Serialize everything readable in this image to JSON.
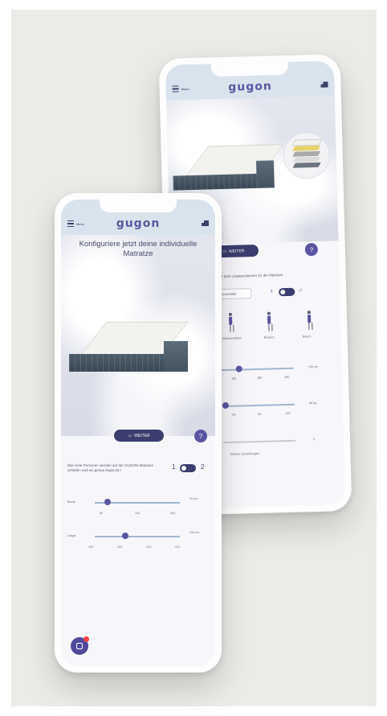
{
  "back_phone": {
    "menu_label": "Menü",
    "logo": "gugon",
    "hero_button": "WEITER",
    "info_text": "Wähle dein Liegepositionen für die Matratze",
    "select_value": "Seitenschläfer",
    "symbols": [
      "♀",
      "♂"
    ],
    "positions": [
      "Seitenschläfer",
      "Rücken",
      "Bauch"
    ],
    "height_unit": "180 cm",
    "height_ticks": [
      "150",
      "180",
      "200"
    ],
    "weight_unit": "80 kg",
    "weight_ticks": [
      "50",
      "80",
      "100"
    ],
    "footer_value": "0",
    "footer_link": "Weitere Einstellungen"
  },
  "front_phone": {
    "menu_label": "Menü",
    "logo": "gugon",
    "headline": "Konfiguriere jetzt deine individuelle Matratze",
    "hero_button": "WEITER",
    "question": "Wie viele Personen werden auf der GUGON Matratze schlafen und wo genau liegst du?",
    "persons": [
      "1",
      "2"
    ],
    "width_label": "Breite",
    "width_value": "90 cm",
    "width_ticks": [
      "80",
      "140",
      "200"
    ],
    "length_label": "Länge",
    "length_value": "200 cm",
    "length_ticks": [
      "190",
      "200",
      "210",
      "220"
    ]
  },
  "colors": {
    "accent": "#5a55a3",
    "dark_button": "#3b3d6e",
    "header": "#d9e3ee",
    "backdrop": "#ecebe8"
  }
}
